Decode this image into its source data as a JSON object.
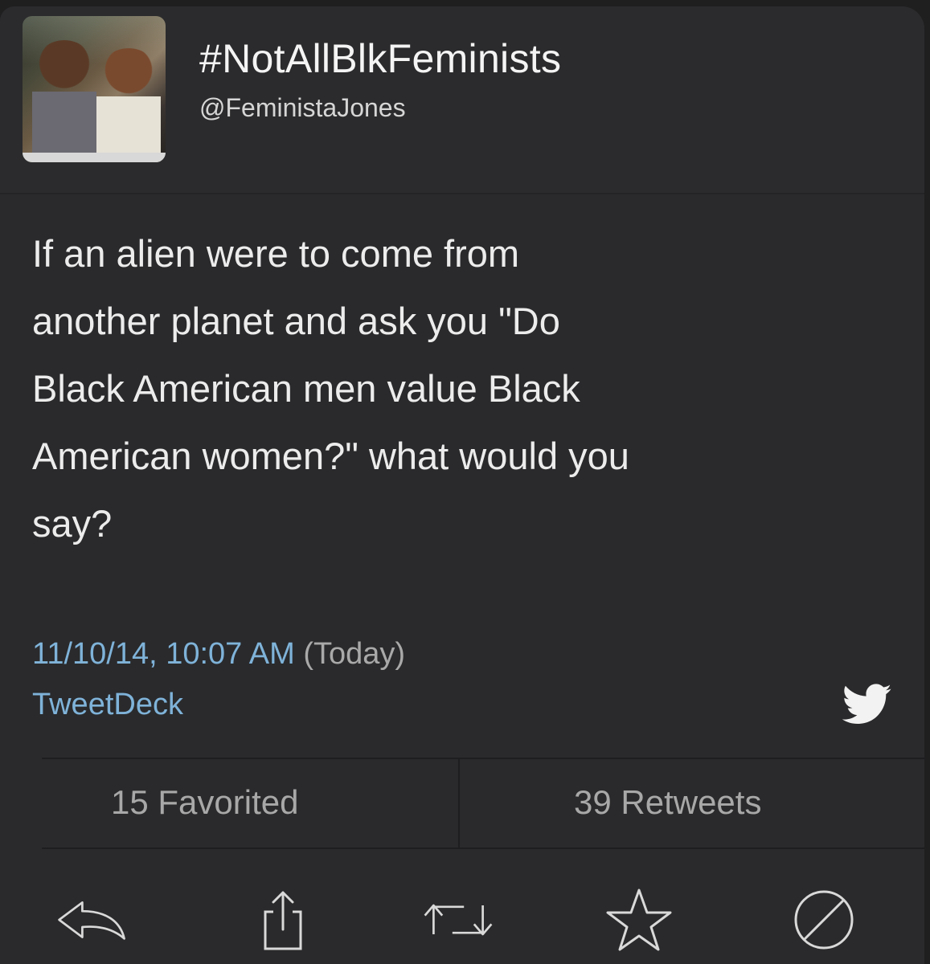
{
  "profile": {
    "display_name": "#NotAllBlkFeminists",
    "handle": "@FeministaJones"
  },
  "tweet": {
    "text": "If an alien were to come from\nanother planet and ask you \"Do\nBlack American men value Black\nAmerican women?\" what would you\nsay?",
    "timestamp": "11/10/14, 10:07 AM",
    "relative_time": "(Today)",
    "source": "TweetDeck"
  },
  "stats": {
    "favorited": "15 Favorited",
    "retweets": "39 Retweets"
  },
  "icons": {
    "avatar": "profile-photo",
    "bird": "twitter-bird-icon",
    "reply": "reply-icon",
    "share": "share-icon",
    "retweet": "retweet-icon",
    "favorite": "star-icon",
    "block": "block-icon"
  },
  "colors": {
    "background": "#2a2a2c",
    "link": "#7fb3d9",
    "text": "#ececec",
    "muted": "#a8a8a8"
  }
}
